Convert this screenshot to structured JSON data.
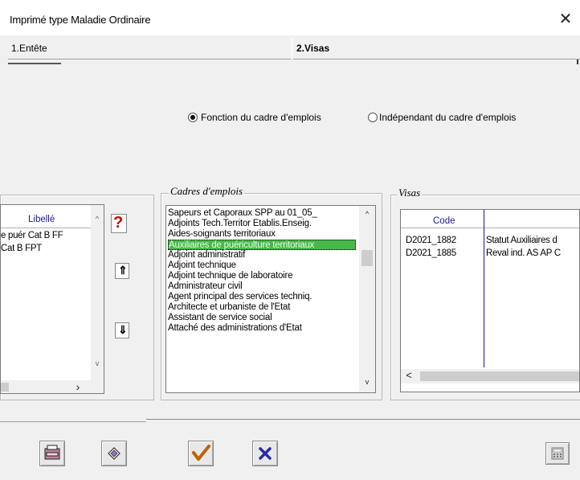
{
  "window": {
    "title": "Imprimé type Maladie Ordinaire",
    "close_glyph": "✕"
  },
  "tabs": [
    {
      "label": "1.Entête"
    },
    {
      "label": "2.Visas"
    }
  ],
  "radios": {
    "option1": "Fonction du cadre d'emplois",
    "option2": "Indépendant du cadre d'emplois",
    "selected": "option1"
  },
  "left_list": {
    "header": "Libellé",
    "rows": [
      "e puér Cat B FF",
      "Cat B FPT"
    ],
    "scroll_right_glyph": "›",
    "scroll_up_glyph": "^",
    "scroll_down_glyph": "v"
  },
  "side_buttons": {
    "help_glyph": "?",
    "up_glyph": "⇑",
    "down_glyph": "⇓"
  },
  "cadres": {
    "caption": "Cadres d'emplois",
    "items": [
      "Sapeurs et Caporaux SPP au 01_05_",
      "Adjoints Tech.Territor Etablis.Enseig.",
      "Aides-soignants territoriaux",
      "Auxiliaires de puériculture territoriaux",
      "Adjoint administratif",
      "Adjoint technique",
      "Adjoint technique de laboratoire",
      "Administrateur civil",
      "Agent principal des services techniq.",
      "Architecte et urbaniste de l'Etat",
      "Assistant de service social",
      "Attaché des administrations d'Etat"
    ],
    "selected_index": 3,
    "scroll_up_glyph": "^",
    "scroll_down_glyph": "v"
  },
  "visas": {
    "caption": "Visas",
    "columns": [
      "Code",
      ""
    ],
    "rows": [
      {
        "code": "D2021_1882",
        "label": "Statut Auxiliaires d"
      },
      {
        "code": "D2021_1885",
        "label": "Reval ind. AS AP C"
      }
    ],
    "scroll_left_glyph": "<"
  },
  "icons": {
    "print": "print-icon",
    "preview": "preview-icon",
    "validate": "check-icon",
    "cancel": "cross-icon",
    "calc": "calculator-icon"
  },
  "colors": {
    "selection": "#48b84a",
    "help": "#cc0000",
    "check": "#c06000",
    "cross": "#2a2aa8"
  }
}
